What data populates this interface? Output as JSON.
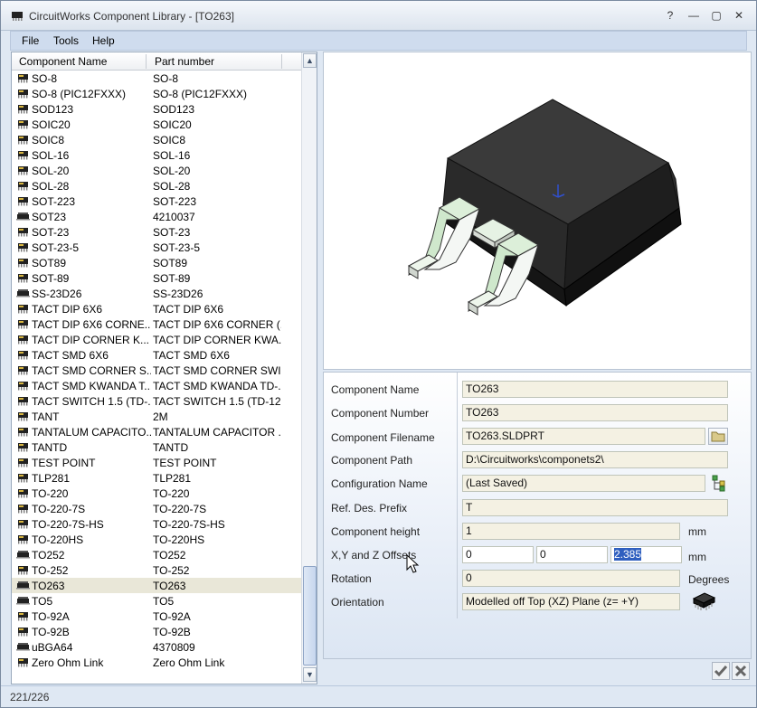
{
  "window": {
    "title": "CircuitWorks Component Library - [TO263]",
    "controls": {
      "help": "?",
      "minimize": "—",
      "maximize": "▢",
      "close": "✕"
    }
  },
  "menu": {
    "items": [
      "File",
      "Tools",
      "Help"
    ]
  },
  "list": {
    "columns": [
      "Component Name",
      "Part number"
    ],
    "selected_index": 33,
    "rows": [
      {
        "name": "SO-8",
        "part": "SO-8",
        "icon": "ic-chip-icon"
      },
      {
        "name": "SO-8 (PIC12FXXX)",
        "part": "SO-8 (PIC12FXXX)",
        "icon": "ic-chip-icon"
      },
      {
        "name": "SOD123",
        "part": "SOD123",
        "icon": "ic-chip-icon"
      },
      {
        "name": "SOIC20",
        "part": "SOIC20",
        "icon": "ic-chip-icon"
      },
      {
        "name": "SOIC8",
        "part": "SOIC8",
        "icon": "ic-chip-icon"
      },
      {
        "name": "SOL-16",
        "part": "SOL-16",
        "icon": "ic-chip-icon"
      },
      {
        "name": "SOL-20",
        "part": "SOL-20",
        "icon": "ic-chip-icon"
      },
      {
        "name": "SOL-28",
        "part": "SOL-28",
        "icon": "ic-chip-icon"
      },
      {
        "name": "SOT-223",
        "part": "SOT-223",
        "icon": "ic-chip-icon"
      },
      {
        "name": "SOT23",
        "part": "4210037",
        "icon": "ic-flat-icon"
      },
      {
        "name": "SOT-23",
        "part": "SOT-23",
        "icon": "ic-chip-icon"
      },
      {
        "name": "SOT-23-5",
        "part": "SOT-23-5",
        "icon": "ic-chip-icon"
      },
      {
        "name": "SOT89",
        "part": "SOT89",
        "icon": "ic-chip-icon"
      },
      {
        "name": "SOT-89",
        "part": "SOT-89",
        "icon": "ic-chip-icon"
      },
      {
        "name": "SS-23D26",
        "part": "SS-23D26",
        "icon": "ic-flat-icon"
      },
      {
        "name": "TACT DIP 6X6",
        "part": "TACT DIP 6X6",
        "icon": "ic-chip-icon"
      },
      {
        "name": "TACT DIP 6X6 CORNE...",
        "part": "TACT DIP 6X6 CORNER (...",
        "icon": "ic-chip-icon"
      },
      {
        "name": "TACT DIP CORNER K...",
        "part": "TACT DIP CORNER KWA...",
        "icon": "ic-chip-icon"
      },
      {
        "name": "TACT SMD 6X6",
        "part": "TACT SMD 6X6",
        "icon": "ic-chip-icon"
      },
      {
        "name": "TACT SMD CORNER S...",
        "part": "TACT SMD CORNER SWI...",
        "icon": "ic-chip-icon"
      },
      {
        "name": "TACT SMD KWANDA T...",
        "part": "TACT SMD KWANDA TD-...",
        "icon": "ic-chip-icon"
      },
      {
        "name": "TACT SWITCH 1.5 (TD-...",
        "part": "TACT SWITCH 1.5 (TD-12...",
        "icon": "ic-chip-icon"
      },
      {
        "name": "TANT",
        "part": "2M",
        "icon": "ic-chip-icon"
      },
      {
        "name": "TANTALUM CAPACITO...",
        "part": "TANTALUM CAPACITOR ...",
        "icon": "ic-chip-icon"
      },
      {
        "name": "TANTD",
        "part": "TANTD",
        "icon": "ic-chip-icon"
      },
      {
        "name": "TEST POINT",
        "part": "TEST POINT",
        "icon": "ic-chip-icon"
      },
      {
        "name": "TLP281",
        "part": "TLP281",
        "icon": "ic-chip-icon"
      },
      {
        "name": "TO-220",
        "part": "TO-220",
        "icon": "ic-chip-icon"
      },
      {
        "name": "TO-220-7S",
        "part": "TO-220-7S",
        "icon": "ic-chip-icon"
      },
      {
        "name": "TO-220-7S-HS",
        "part": "TO-220-7S-HS",
        "icon": "ic-chip-icon"
      },
      {
        "name": "TO-220HS",
        "part": "TO-220HS",
        "icon": "ic-chip-icon"
      },
      {
        "name": "TO252",
        "part": "TO252",
        "icon": "ic-flat-icon"
      },
      {
        "name": "TO-252",
        "part": "TO-252",
        "icon": "ic-chip-icon"
      },
      {
        "name": "TO263",
        "part": "TO263",
        "icon": "ic-flat-icon"
      },
      {
        "name": "TO5",
        "part": "TO5",
        "icon": "ic-flat-icon"
      },
      {
        "name": "TO-92A",
        "part": "TO-92A",
        "icon": "ic-chip-icon"
      },
      {
        "name": "TO-92B",
        "part": "TO-92B",
        "icon": "ic-chip-icon"
      },
      {
        "name": "uBGA64",
        "part": "4370809",
        "icon": "ic-flat-icon"
      },
      {
        "name": "Zero Ohm Link",
        "part": "Zero Ohm Link",
        "icon": "ic-chip-icon"
      }
    ]
  },
  "properties": {
    "component_name": {
      "label": "Component Name",
      "value": "TO263"
    },
    "component_number": {
      "label": "Component Number",
      "value": "TO263"
    },
    "component_filename": {
      "label": "Component Filename",
      "value": "TO263.SLDPRT"
    },
    "component_path": {
      "label": "Component Path",
      "value": "D:\\Circuitworks\\componets2\\"
    },
    "configuration_name": {
      "label": "Configuration Name",
      "value": "(Last Saved)"
    },
    "ref_des_prefix": {
      "label": "Ref. Des. Prefix",
      "value": "T"
    },
    "component_height": {
      "label": "Component height",
      "value": "1",
      "unit": "mm"
    },
    "offsets": {
      "label": "X,Y and Z Offsets",
      "x": "0",
      "y": "0",
      "z": "2.385",
      "unit": "mm"
    },
    "rotation": {
      "label": "Rotation",
      "value": "0",
      "unit": "Degrees"
    },
    "orientation": {
      "label": "Orientation",
      "value": "Modelled off Top (XZ) Plane (z= +Y)"
    }
  },
  "status": {
    "count": "221/226"
  },
  "colors": {
    "accent": "#2f5fbf",
    "field_bg": "#f4f1e3",
    "selected_row": "#e9e7d8"
  }
}
